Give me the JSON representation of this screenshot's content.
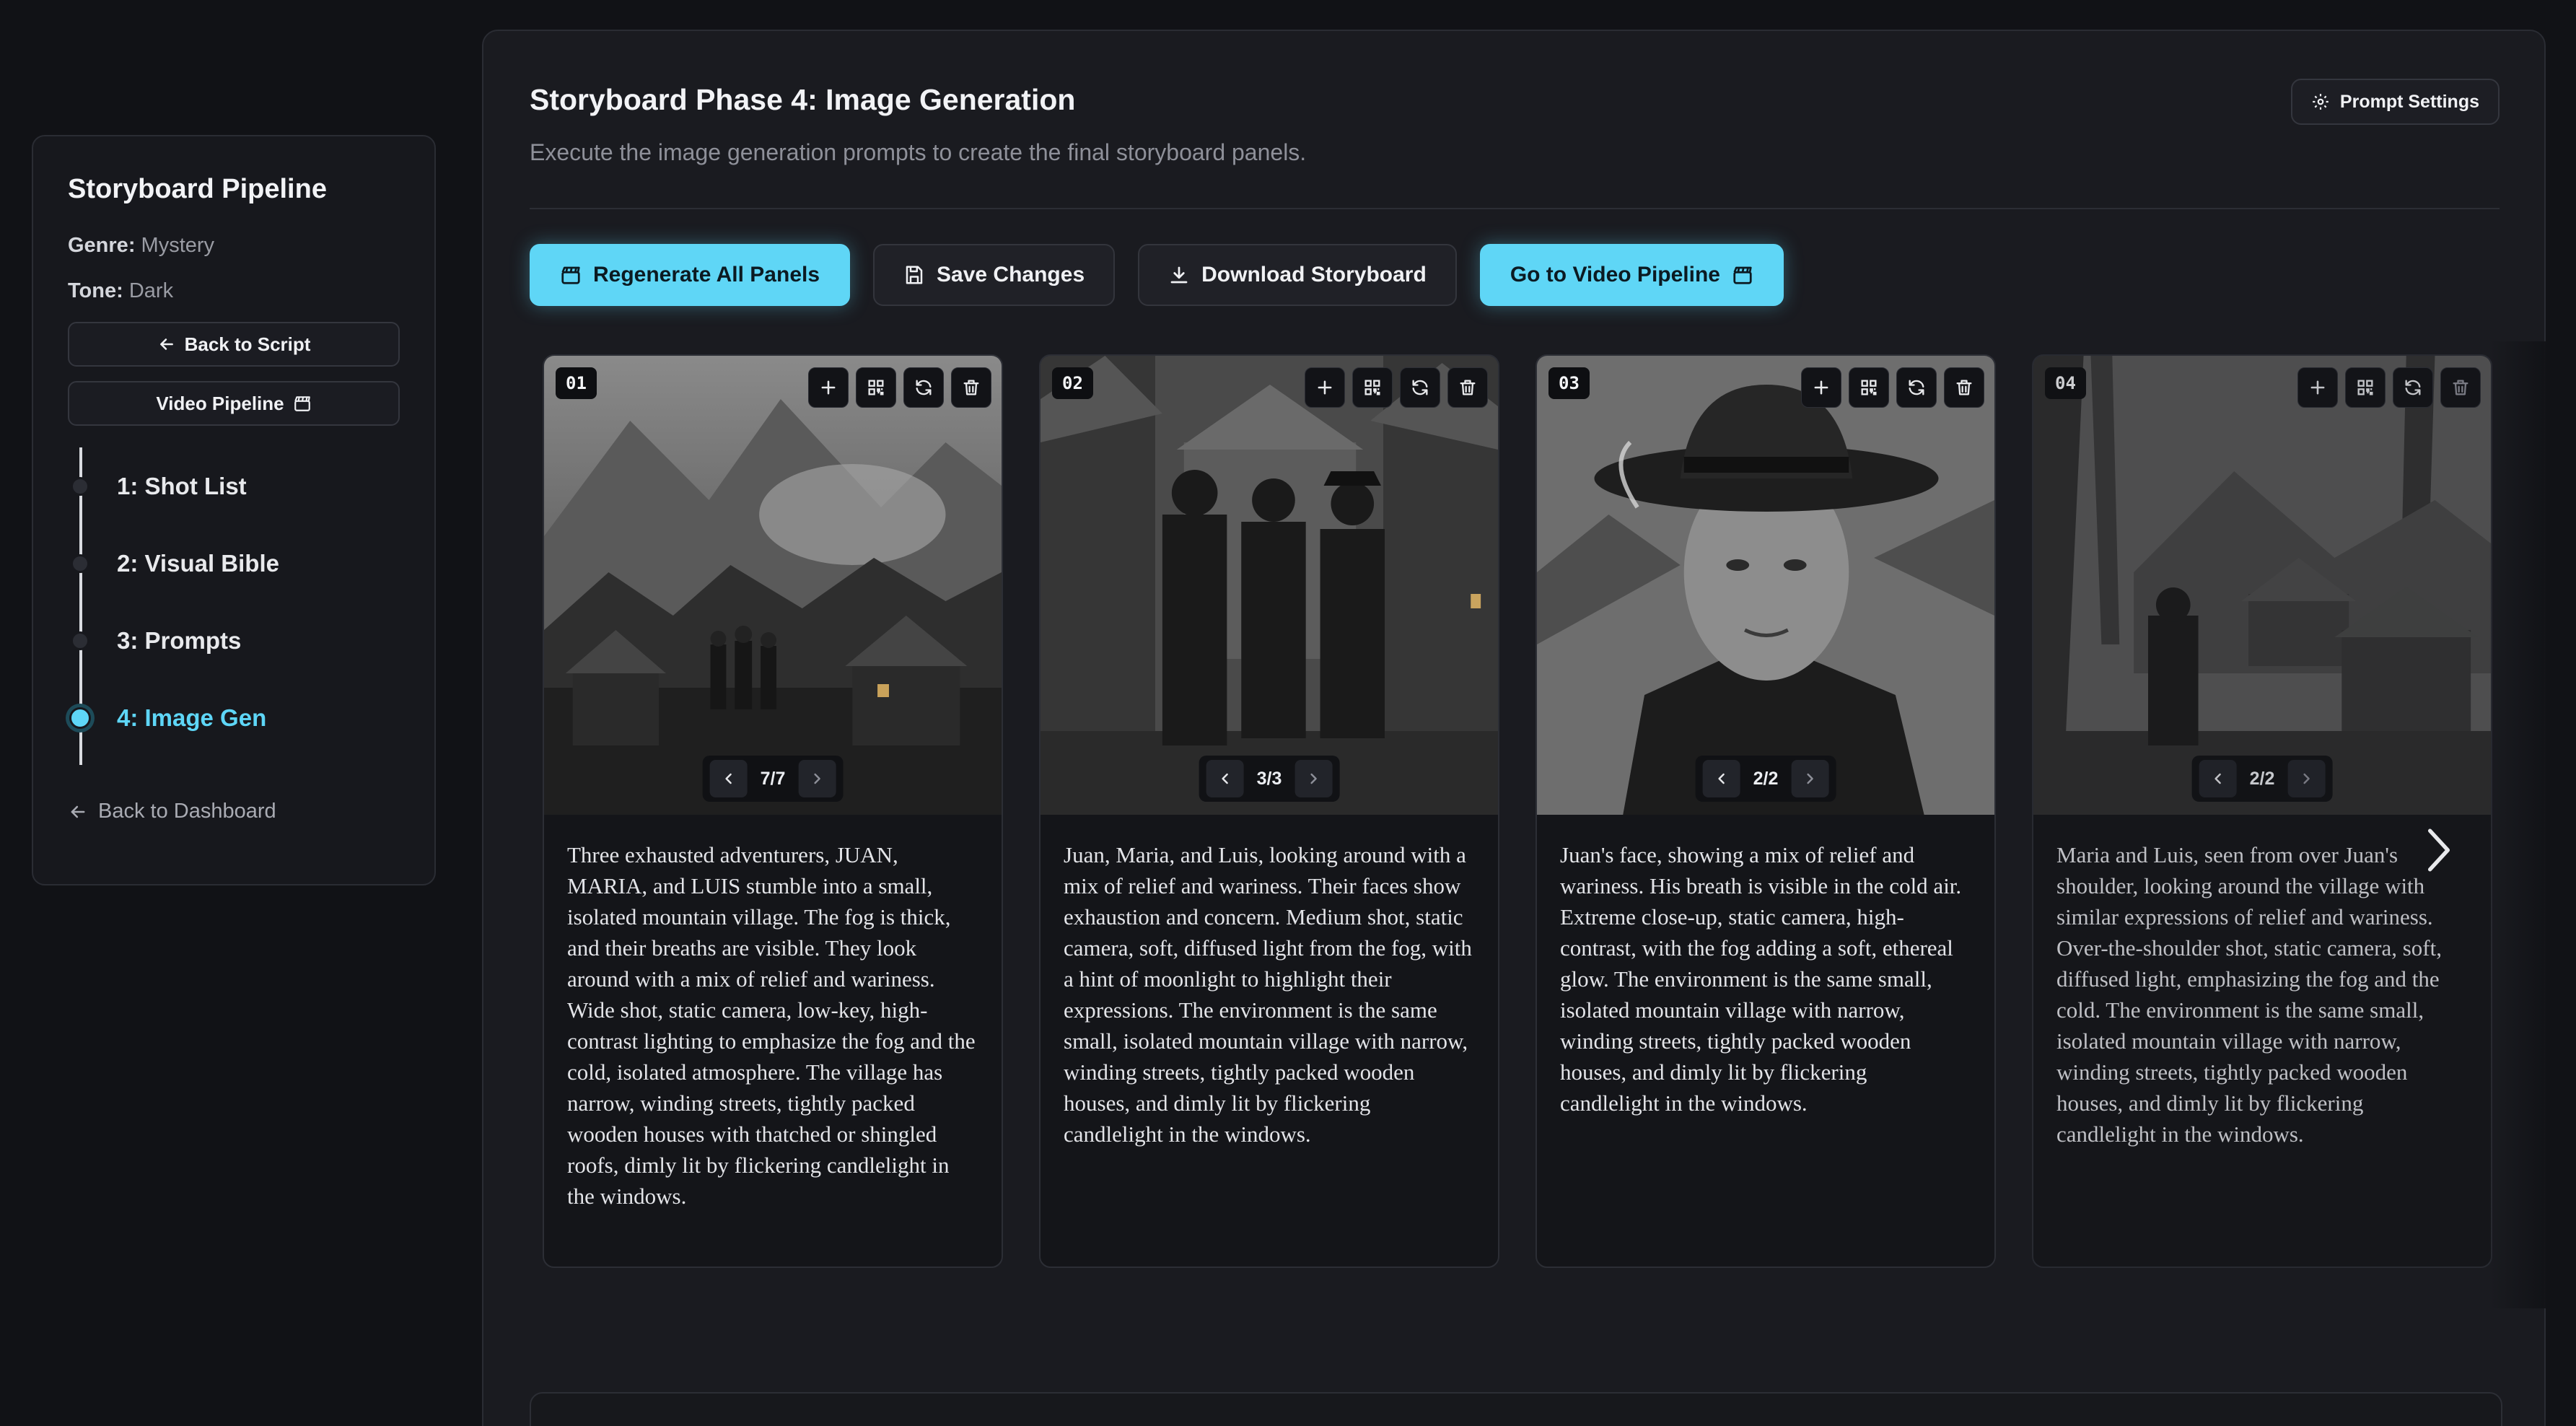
{
  "sidebar": {
    "title": "Storyboard Pipeline",
    "genre_label": "Genre:",
    "genre": "Mystery",
    "tone_label": "Tone:",
    "tone": "Dark",
    "back_to_script": "Back to Script",
    "video_pipeline": "Video Pipeline",
    "steps": [
      {
        "label": "1: Shot List",
        "active": false
      },
      {
        "label": "2: Visual Bible",
        "active": false
      },
      {
        "label": "3: Prompts",
        "active": false
      },
      {
        "label": "4: Image Gen",
        "active": true
      }
    ],
    "back_to_dashboard": "Back to Dashboard"
  },
  "header": {
    "title": "Storyboard Phase 4: Image Generation",
    "subtitle": "Execute the image generation prompts to create the final storyboard panels.",
    "prompt_settings": "Prompt Settings"
  },
  "toolbar": {
    "regenerate_all": "Regenerate All Panels",
    "save_changes": "Save Changes",
    "download": "Download Storyboard",
    "go_video": "Go to Video Pipeline"
  },
  "panels": [
    {
      "number": "01",
      "pager": "7/7",
      "text": "Three exhausted adventurers, JUAN, MARIA, and LUIS stumble into a small, isolated mountain village. The fog is thick, and their breaths are visible. They look around with a mix of relief and wariness. Wide shot, static camera, low-key, high-contrast lighting to emphasize the fog and the cold, isolated atmosphere. The village has narrow, winding streets, tightly packed wooden houses with thatched or shingled roofs, dimly lit by flickering candlelight in the windows."
    },
    {
      "number": "02",
      "pager": "3/3",
      "text": "Juan, Maria, and Luis, looking around with a mix of relief and wariness. Their faces show exhaustion and concern. Medium shot, static camera, soft, diffused light from the fog, with a hint of moonlight to highlight their expressions. The environment is the same small, isolated mountain village with narrow, winding streets, tightly packed wooden houses, and dimly lit by flickering candlelight in the windows."
    },
    {
      "number": "03",
      "pager": "2/2",
      "text": "Juan's face, showing a mix of relief and wariness. His breath is visible in the cold air. Extreme close-up, static camera, high-contrast, with the fog adding a soft, ethereal glow. The environment is the same small, isolated mountain village with narrow, winding streets, tightly packed wooden houses, and dimly lit by flickering candlelight in the windows."
    },
    {
      "number": "04",
      "pager": "2/2",
      "text": "Maria and Luis, seen from over Juan's shoulder, looking around the village with similar expressions of relief and wariness. Over-the-shoulder shot, static camera, soft, diffused light, emphasizing the fog and the cold. The environment is the same small, isolated mountain village with narrow, winding streets, tightly packed wooden houses, and dimly lit by flickering candlelight in the windows."
    }
  ],
  "colors": {
    "accent": "#5fd6f6",
    "background": "#111216",
    "card": "#1a1b20"
  }
}
